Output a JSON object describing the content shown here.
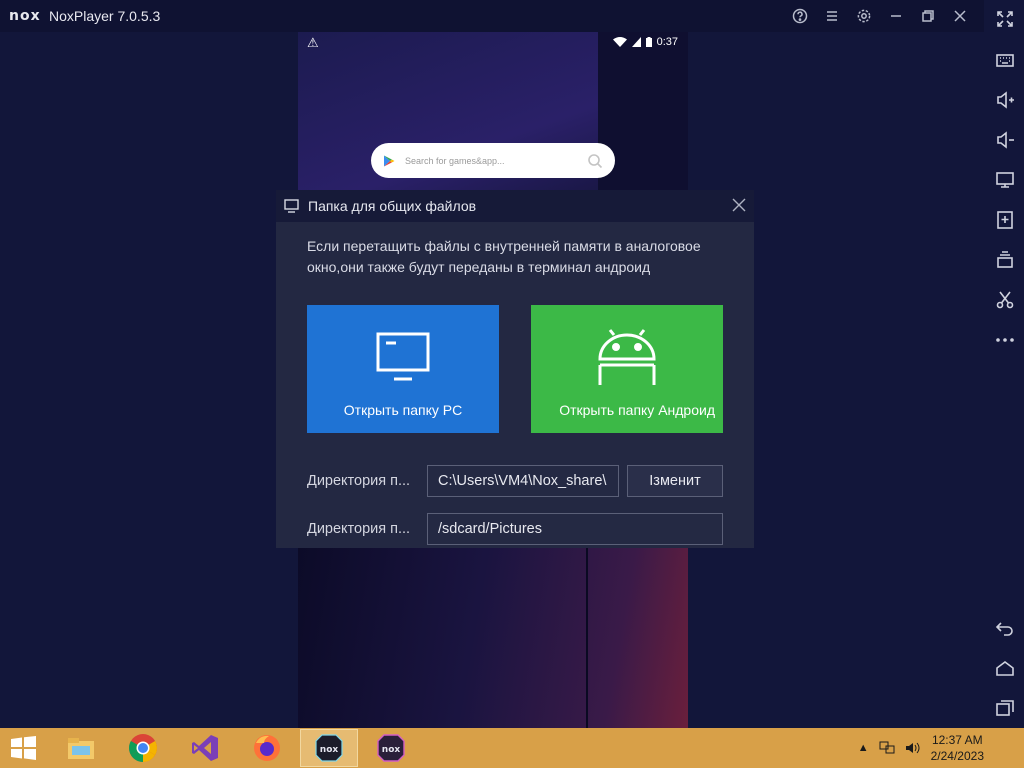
{
  "app": {
    "logo_text": "nox",
    "title": "NoxPlayer 7.0.5.3"
  },
  "window_controls": [
    "help-icon",
    "menu-icon",
    "settings-icon",
    "minimize-icon",
    "restore-icon",
    "close-icon",
    "fullscreen-icon"
  ],
  "sidebar": {
    "top_icon": "fullscreen-icon",
    "items": [
      "keyboard-icon",
      "volume-up-icon",
      "volume-down-icon",
      "screen-icon",
      "add-apk-icon",
      "multi-instance-icon",
      "screenshot-icon",
      "more-icon"
    ],
    "bottom_items": [
      "back-icon",
      "home-icon",
      "recent-apps-icon"
    ]
  },
  "android": {
    "status": {
      "warning_icon": "warning-icon",
      "time": "0:37"
    },
    "search": {
      "placeholder": "Search for games&app..."
    }
  },
  "dialog": {
    "title": "Папка для общих файлов",
    "description": "Если перетащить файлы с внутренней памяти в аналоговое окно,они также будут переданы в терминал андроид",
    "pc_button_label": "Открыть папку PC",
    "android_button_label": "Открыть папку Андроид",
    "pc_dir_label": "Директория п...",
    "pc_dir_value": "C:\\Users\\VM4\\Nox_share\\",
    "change_button_label": "Ізменит",
    "android_dir_label": "Директория п...",
    "android_dir_value": "/sdcard/Pictures"
  },
  "taskbar": {
    "apps": [
      "file-explorer-icon",
      "chrome-icon",
      "visual-studio-icon",
      "firefox-icon",
      "nox-icon",
      "nox-multi-icon"
    ],
    "active_app": "nox-icon",
    "clock_time": "12:37 AM",
    "clock_date": "2/24/2023"
  },
  "colors": {
    "pc_button": "#1f73d4",
    "android_button": "#3cb947",
    "taskbar": "#d8a048"
  }
}
